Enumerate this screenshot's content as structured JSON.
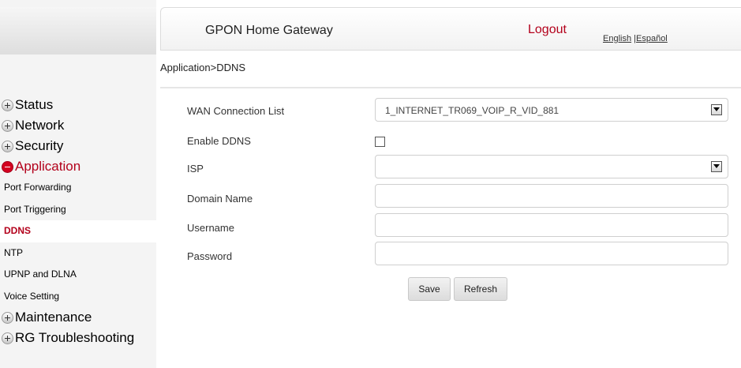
{
  "header": {
    "title": "GPON Home Gateway",
    "logout": "Logout",
    "lang_english": "English",
    "lang_separator": "|",
    "lang_spanish": "Español"
  },
  "breadcrumb": "Application>DDNS",
  "sidebar": {
    "menu": [
      {
        "label": "Status",
        "icon": "plus-icon"
      },
      {
        "label": "Network",
        "icon": "plus-icon"
      },
      {
        "label": "Security",
        "icon": "plus-icon"
      },
      {
        "label": "Application",
        "icon": "minus-icon",
        "active": true
      }
    ],
    "submenu": [
      {
        "label": "Port Forwarding"
      },
      {
        "label": "Port Triggering"
      },
      {
        "label": "DDNS",
        "active": true
      },
      {
        "label": "NTP"
      },
      {
        "label": "UPNP and DLNA"
      },
      {
        "label": "Voice Setting"
      }
    ],
    "menu_after": [
      {
        "label": "Maintenance",
        "icon": "plus-icon"
      },
      {
        "label": "RG Troubleshooting",
        "icon": "plus-icon"
      }
    ]
  },
  "form": {
    "wan_label": "WAN Connection List",
    "wan_value": "1_INTERNET_TR069_VOIP_R_VID_881",
    "enable_label": "Enable DDNS",
    "enable_checked": false,
    "isp_label": "ISP",
    "isp_value": "",
    "domain_label": "Domain Name",
    "domain_value": "",
    "username_label": "Username",
    "username_value": "",
    "password_label": "Password",
    "password_value": ""
  },
  "buttons": {
    "save": "Save",
    "refresh": "Refresh"
  },
  "colors": {
    "accent": "#b3001b",
    "sidebar_bg": "#f4f4f4"
  }
}
